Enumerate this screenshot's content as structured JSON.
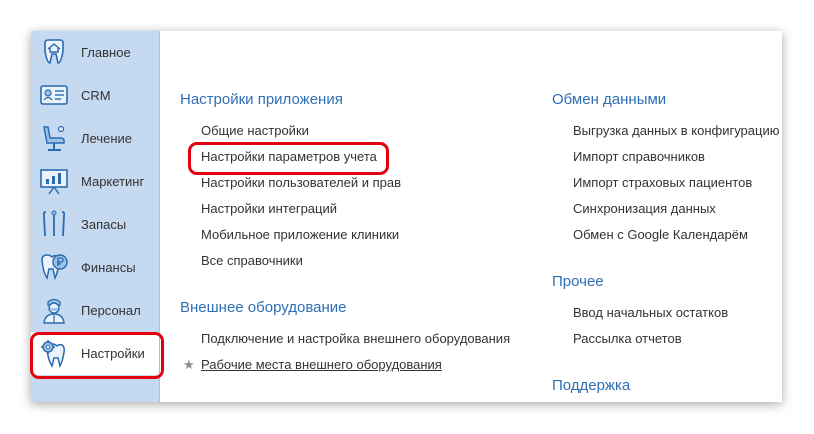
{
  "sidebar": {
    "items": [
      {
        "label": "Главное",
        "icon": "tooth-home-icon"
      },
      {
        "label": "CRM",
        "icon": "crm-card-icon"
      },
      {
        "label": "Лечение",
        "icon": "dental-chair-icon"
      },
      {
        "label": "Маркетинг",
        "icon": "presentation-board-icon"
      },
      {
        "label": "Запасы",
        "icon": "dental-tools-icon"
      },
      {
        "label": "Финансы",
        "icon": "tooth-ruble-icon"
      },
      {
        "label": "Персонал",
        "icon": "doctor-icon"
      },
      {
        "label": "Настройки",
        "icon": "tooth-gear-icon"
      }
    ],
    "active_index": 7
  },
  "main": {
    "app_settings": {
      "title": "Настройки приложения",
      "links": [
        "Общие настройки",
        "Настройки параметров учета",
        "Настройки пользователей и прав",
        "Настройки интеграций",
        "Мобильное приложение клиники",
        "Все справочники"
      ]
    },
    "external_equipment": {
      "title": "Внешнее оборудование",
      "links": [
        "Подключение и настройка внешнего оборудования",
        "Рабочие места внешнего оборудования"
      ]
    },
    "data_exchange": {
      "title": "Обмен данными",
      "links": [
        "Выгрузка данных в конфигурацию",
        "Импорт справочников",
        "Импорт страховых пациентов",
        "Синхронизация данных",
        "Обмен с Google Календарём"
      ]
    },
    "other": {
      "title": "Прочее",
      "links": [
        "Ввод начальных остатков",
        "Рассылка отчетов"
      ]
    },
    "support": {
      "title": "Поддержка"
    }
  },
  "colors": {
    "sidebar_bg": "#c5d9f1",
    "section_title": "#2f6fb4",
    "highlight": "#e3000f",
    "icon_blue": "#2a6ab0",
    "icon_light": "#9ec3e8"
  }
}
